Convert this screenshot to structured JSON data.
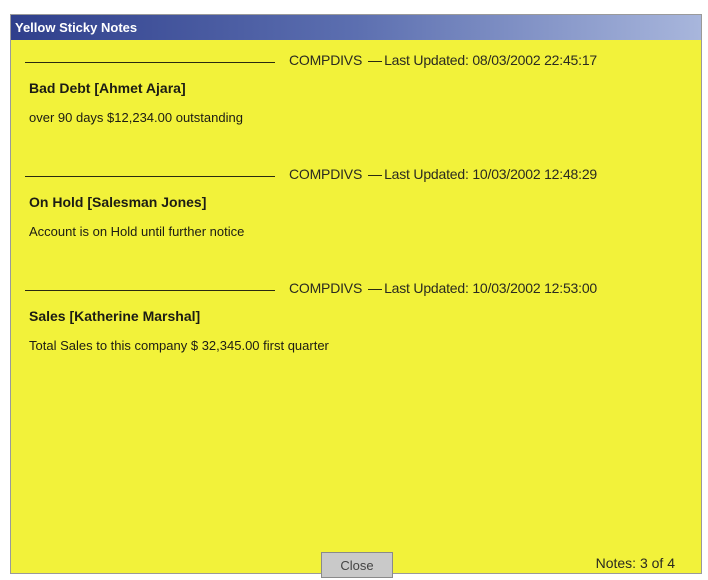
{
  "window": {
    "title": "Yellow Sticky Notes"
  },
  "notes": [
    {
      "author": "COMPDIVS",
      "updated": "Last Updated: 08/03/2002 22:45:17",
      "title": "Bad Debt [Ahmet Ajara]",
      "body": "over 90 days $12,234.00 outstanding"
    },
    {
      "author": "COMPDIVS",
      "updated": "Last Updated: 10/03/2002 12:48:29",
      "title": "On Hold [Salesman Jones]",
      "body": "Account is on Hold until further notice"
    },
    {
      "author": "COMPDIVS",
      "updated": "Last Updated: 10/03/2002 12:53:00",
      "title": "Sales [Katherine Marshal]",
      "body": "Total Sales to this company $ 32,345.00 first quarter"
    }
  ],
  "footer": {
    "close_label": "Close",
    "count": "Notes: 3 of 4"
  },
  "colors": {
    "background": "#f2f23a",
    "titlebar_start": "#2f3f8c",
    "titlebar_end": "#a8b6dc"
  }
}
